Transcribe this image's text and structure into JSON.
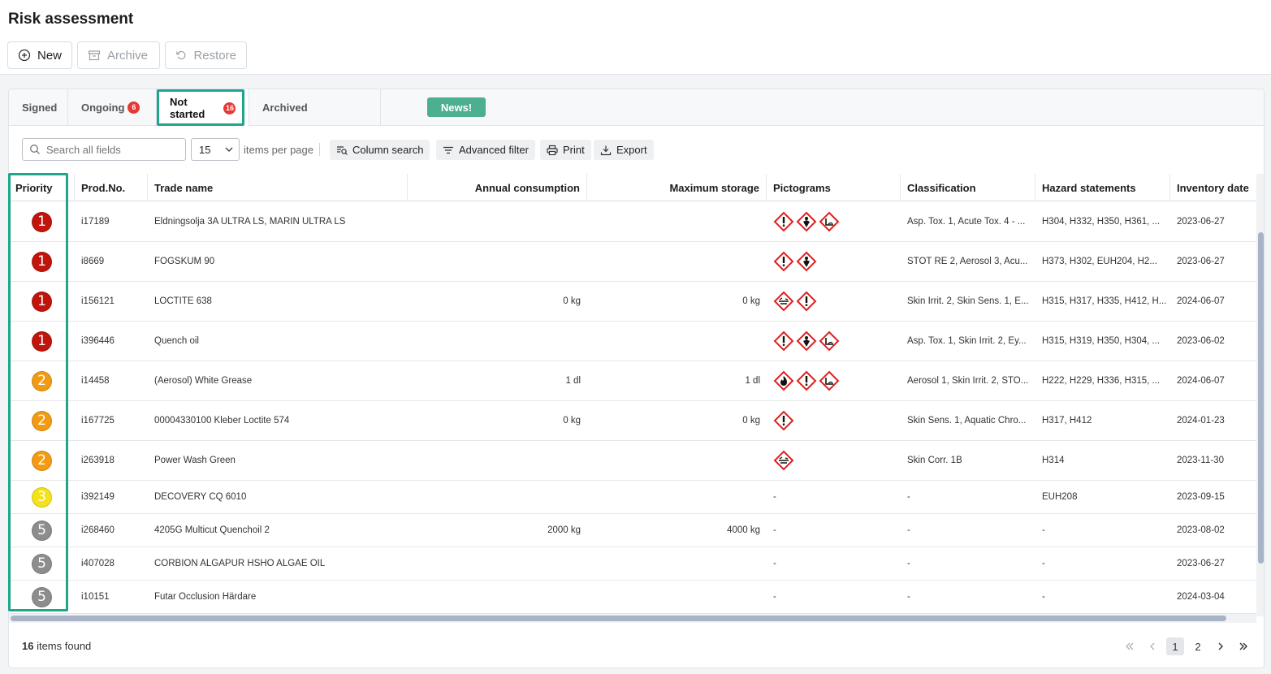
{
  "page": {
    "title": "Risk assessment"
  },
  "toolbar": {
    "new_label": "New",
    "archive_label": "Archive",
    "restore_label": "Restore"
  },
  "tabs": [
    {
      "label": "Signed",
      "badge": ""
    },
    {
      "label": "Ongoing",
      "badge": "6"
    },
    {
      "label": "Not started",
      "badge": "16"
    },
    {
      "label": "Archived",
      "badge": ""
    }
  ],
  "news_label": "News!",
  "filters": {
    "search_placeholder": "Search all fields",
    "per_page_value": "15",
    "per_page_label": "items per page",
    "column_search": "Column search",
    "advanced_filter": "Advanced filter",
    "print": "Print",
    "export": "Export"
  },
  "columns": {
    "priority": "Priority",
    "prod_no": "Prod.No.",
    "trade_name": "Trade name",
    "annual_consumption": "Annual consumption",
    "maximum_storage": "Maximum storage",
    "pictograms": "Pictograms",
    "classification": "Classification",
    "hazard_statements": "Hazard statements",
    "inventory_date": "Inventory date"
  },
  "priority_colors": {
    "1": "#c0140c",
    "2": "#f39a12",
    "3": "#f5e21a",
    "5": "#8d8d8d"
  },
  "rows": [
    {
      "priority": "1",
      "prod_no": "i17189",
      "trade_name": "Eldningsolja 3A ULTRA LS, MARIN ULTRA LS",
      "annual": "",
      "storage": "",
      "pictograms": [
        "exclamation-pictogram",
        "health-hazard-pictogram",
        "environment-pictogram"
      ],
      "classification": "Asp. Tox. 1, Acute Tox. 4 - ...",
      "hazard": "H304, H332, H350, H361, ...",
      "date": "2023-06-27"
    },
    {
      "priority": "1",
      "prod_no": "i8669",
      "trade_name": "FOGSKUM 90",
      "annual": "",
      "storage": "",
      "pictograms": [
        "exclamation-pictogram",
        "health-hazard-pictogram"
      ],
      "classification": "STOT RE 2, Aerosol 3, Acu...",
      "hazard": "H373, H302, EUH204, H2...",
      "date": "2023-06-27"
    },
    {
      "priority": "1",
      "prod_no": "i156121",
      "trade_name": "LOCTITE 638",
      "annual": "0 kg",
      "storage": "0 kg",
      "pictograms": [
        "corrosion-pictogram",
        "exclamation-pictogram"
      ],
      "classification": "Skin Irrit. 2, Skin Sens. 1, E...",
      "hazard": "H315, H317, H335, H412, H...",
      "date": "2024-06-07"
    },
    {
      "priority": "1",
      "prod_no": "i396446",
      "trade_name": "Quench oil",
      "annual": "",
      "storage": "",
      "pictograms": [
        "exclamation-pictogram",
        "health-hazard-pictogram",
        "environment-pictogram"
      ],
      "classification": "Asp. Tox. 1, Skin Irrit. 2, Ey...",
      "hazard": "H315, H319, H350, H304, ...",
      "date": "2023-06-02"
    },
    {
      "priority": "2",
      "prod_no": "i14458",
      "trade_name": "(Aerosol) White Grease",
      "annual": "1 dl",
      "storage": "1 dl",
      "pictograms": [
        "flame-pictogram",
        "exclamation-pictogram",
        "environment-pictogram"
      ],
      "classification": "Aerosol 1, Skin Irrit. 2, STO...",
      "hazard": "H222, H229, H336, H315, ...",
      "date": "2024-06-07"
    },
    {
      "priority": "2",
      "prod_no": "i167725",
      "trade_name": "00004330100 Kleber Loctite 574",
      "annual": "0 kg",
      "storage": "0 kg",
      "pictograms": [
        "exclamation-pictogram"
      ],
      "classification": "Skin Sens. 1, Aquatic Chro...",
      "hazard": "H317, H412",
      "date": "2024-01-23"
    },
    {
      "priority": "2",
      "prod_no": "i263918",
      "trade_name": "Power Wash Green",
      "annual": "",
      "storage": "",
      "pictograms": [
        "corrosion-pictogram"
      ],
      "classification": "Skin Corr. 1B",
      "hazard": "H314",
      "date": "2023-11-30"
    },
    {
      "priority": "3",
      "prod_no": "i392149",
      "trade_name": "DECOVERY CQ 6010",
      "annual": "",
      "storage": "",
      "pictograms": [],
      "picto_text": "-",
      "classification": "-",
      "hazard": "EUH208",
      "date": "2023-09-15"
    },
    {
      "priority": "5",
      "prod_no": "i268460",
      "trade_name": "4205G Multicut Quenchoil 2",
      "annual": "2000 kg",
      "storage": "4000 kg",
      "pictograms": [],
      "picto_text": "-",
      "classification": "-",
      "hazard": "-",
      "date": "2023-08-02"
    },
    {
      "priority": "5",
      "prod_no": "i407028",
      "trade_name": "CORBION ALGAPUR HSHO ALGAE OIL",
      "annual": "",
      "storage": "",
      "pictograms": [],
      "picto_text": "-",
      "classification": "-",
      "hazard": "-",
      "date": "2023-06-27"
    },
    {
      "priority": "5",
      "prod_no": "i10151",
      "trade_name": "Futar Occlusion Härdare",
      "annual": "",
      "storage": "",
      "pictograms": [],
      "picto_text": "-",
      "classification": "-",
      "hazard": "-",
      "date": "2024-03-04"
    }
  ],
  "footer": {
    "count": "16",
    "count_label": " items found",
    "pages": [
      "1",
      "2"
    ],
    "current_page": "1"
  }
}
